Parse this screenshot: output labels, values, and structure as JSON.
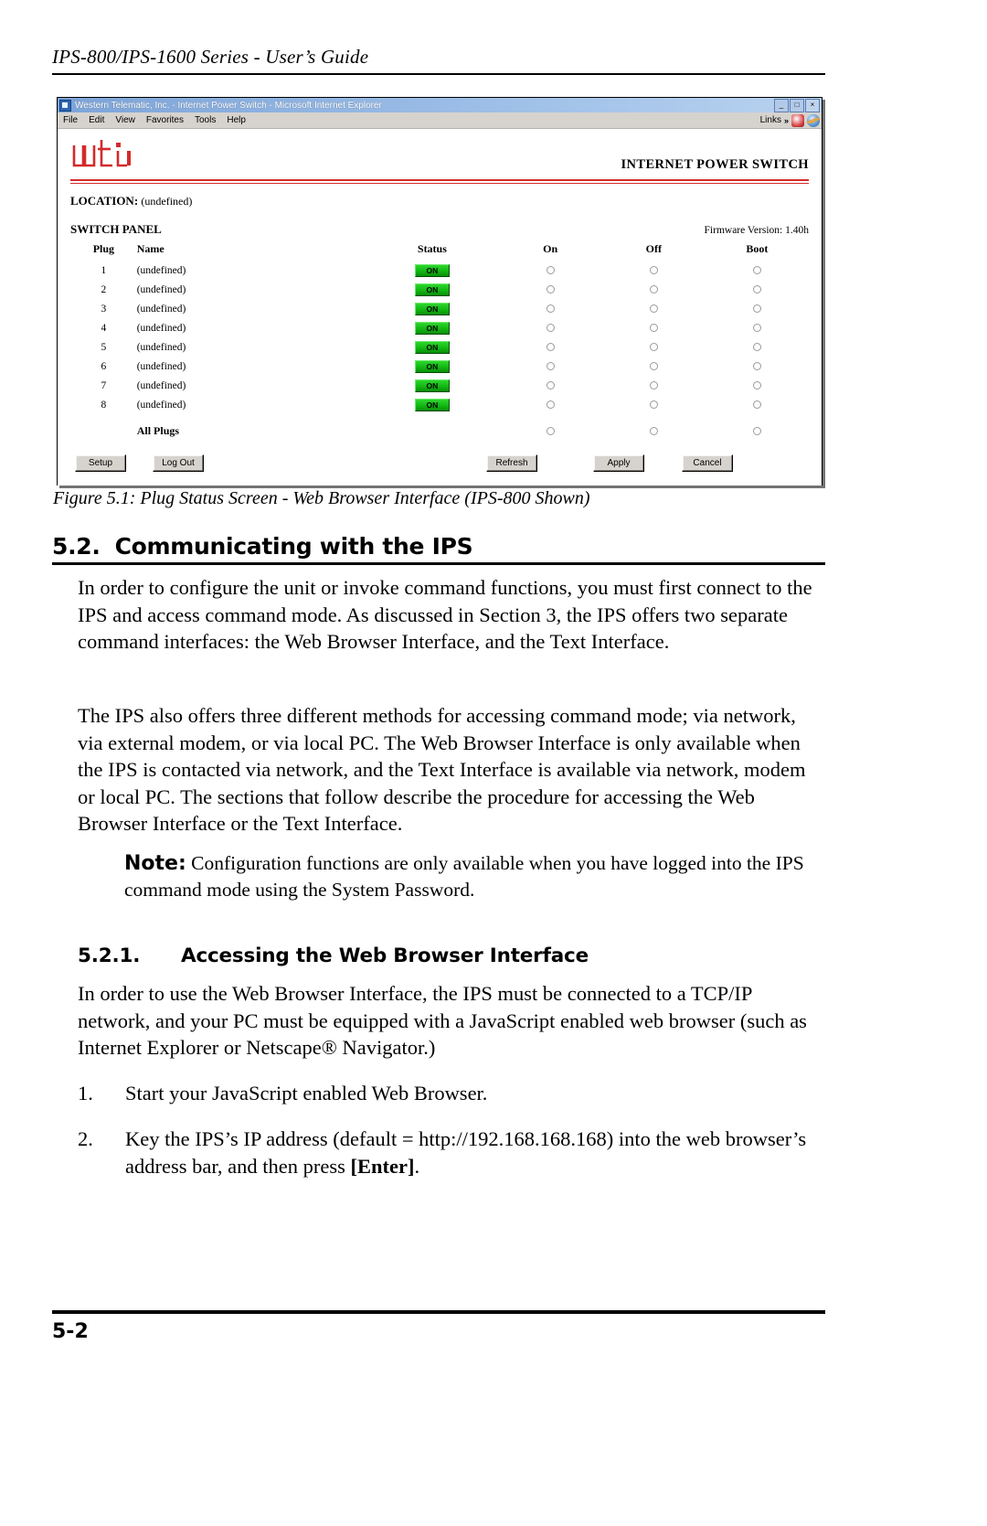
{
  "page": {
    "header": "IPS-800/IPS-1600 Series - User’s Guide",
    "footer_page": "5-2"
  },
  "browser": {
    "title": "Western Telematic, Inc. - Internet Power Switch - Microsoft Internet Explorer",
    "window_buttons": {
      "minimize": "_",
      "maximize": "□",
      "close": "×"
    },
    "menus": [
      "File",
      "Edit",
      "View",
      "Favorites",
      "Tools",
      "Help"
    ],
    "links_label": "Links",
    "links_chevron": "»"
  },
  "app": {
    "logo_text": "wti",
    "banner_title": "INTERNET POWER SWITCH",
    "location_label": "LOCATION:",
    "location_value": "(undefined)",
    "panel_title": "SWITCH PANEL",
    "firmware": "Firmware Version: 1.40h",
    "columns": [
      "Plug",
      "Name",
      "Status",
      "On",
      "Off",
      "Boot"
    ],
    "rows": [
      {
        "plug": "1",
        "name": "(undefined)",
        "status": "ON"
      },
      {
        "plug": "2",
        "name": "(undefined)",
        "status": "ON"
      },
      {
        "plug": "3",
        "name": "(undefined)",
        "status": "ON"
      },
      {
        "plug": "4",
        "name": "(undefined)",
        "status": "ON"
      },
      {
        "plug": "5",
        "name": "(undefined)",
        "status": "ON"
      },
      {
        "plug": "6",
        "name": "(undefined)",
        "status": "ON"
      },
      {
        "plug": "7",
        "name": "(undefined)",
        "status": "ON"
      },
      {
        "plug": "8",
        "name": "(undefined)",
        "status": "ON"
      }
    ],
    "all_plugs_label": "All Plugs",
    "buttons": {
      "setup": "Setup",
      "logout": "Log Out",
      "refresh": "Refresh",
      "apply": "Apply",
      "cancel": "Cancel"
    },
    "colors": {
      "logo_red": "#d42a2a",
      "status_green": "#12b812",
      "titlebar_blue": "#7da4d8",
      "chrome_gray": "#d6d3ce"
    }
  },
  "figure": {
    "caption": "Figure 5.1:  Plug Status Screen - Web Browser Interface (IPS-800 Shown)"
  },
  "section": {
    "number": "5.2.",
    "title": "Communicating with the IPS",
    "paragraph1": "In order to configure the unit or invoke command functions, you must first connect to the IPS and access command mode.  As discussed in Section 3, the IPS offers two separate command interfaces: the Web Browser Interface, and the Text Interface.",
    "paragraph2": "The IPS also offers three different methods for accessing command mode; via network, via external modem, or via local PC.  The Web Browser Interface is only available when the IPS is contacted via network, and the Text Interface is available via network, modem or local PC.  The sections that follow describe the procedure for accessing the Web Browser Interface or the Text Interface.",
    "note_label": "Note:",
    "note_text": "Configuration functions are only available when you have logged into the IPS command mode using the System Password."
  },
  "subsection": {
    "number": "5.2.1.",
    "title": "Accessing the Web Browser Interface",
    "paragraph": "In order to use the Web Browser Interface, the IPS must be connected to a TCP/IP network, and your PC must be equipped with a JavaScript enabled web browser (such as Internet Explorer or Netscape® Navigator.)",
    "steps": [
      {
        "num": "1.",
        "text": "Start your JavaScript enabled Web Browser."
      },
      {
        "num": "2.",
        "text_before": "Key the IPS’s IP address (default = http://192.168.168.168) into the web browser’s address bar, and then press ",
        "text_bold": "[Enter]",
        "text_after": "."
      }
    ]
  }
}
